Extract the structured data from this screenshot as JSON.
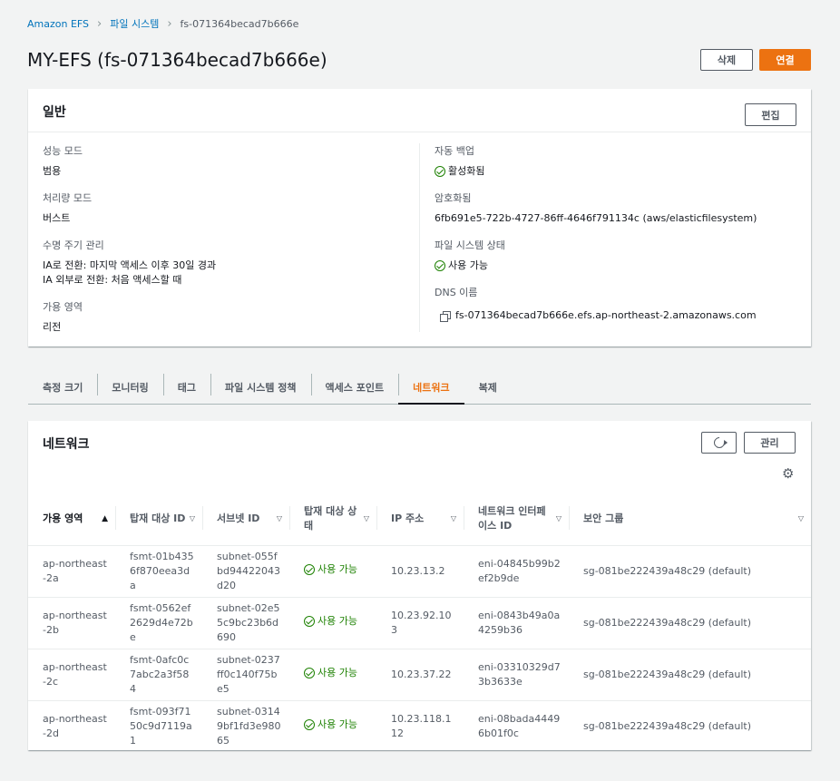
{
  "breadcrumb": [
    "Amazon EFS",
    "파일 시스템",
    "fs-071364becad7b666e"
  ],
  "title": "MY-EFS (fs-071364becad7b666e)",
  "actions": {
    "delete": "삭제",
    "connect": "연결"
  },
  "general": {
    "heading": "일반",
    "edit": "편집",
    "performance_mode": {
      "label": "성능 모드",
      "value": "범용"
    },
    "throughput_mode": {
      "label": "처리량 모드",
      "value": "버스트"
    },
    "lifecycle": {
      "label": "수명 주기 관리",
      "value1": "IA로 전환: 마지막 액세스 이후 30일 경과",
      "value2": "IA 외부로 전환: 처음 액세스할 때"
    },
    "availability_zone": {
      "label": "가용 영역",
      "value": "리전"
    },
    "auto_backup": {
      "label": "자동 백업",
      "value": "활성화됨"
    },
    "encryption": {
      "label": "암호화됨",
      "value": "6fb691e5-722b-4727-86ff-4646f791134c (aws/elasticfilesystem)"
    },
    "fs_state": {
      "label": "파일 시스템 상태",
      "value": "사용 가능"
    },
    "dns": {
      "label": "DNS 이름",
      "value": "fs-071364becad7b666e.efs.ap-northeast-2.amazonaws.com"
    }
  },
  "tabs": [
    "측정 크기",
    "모니터링",
    "태그",
    "파일 시스템 정책",
    "액세스 포인트",
    "네트워크",
    "복제"
  ],
  "active_tab": "네트워크",
  "network": {
    "heading": "네트워크",
    "manage": "관리",
    "columns": [
      {
        "label": "가용 영역",
        "sort": "▲"
      },
      {
        "label": "탑재 대상 ID",
        "sort": "▽"
      },
      {
        "label": "서브넷 ID",
        "sort": "▽"
      },
      {
        "label": "탑재 대상 상태",
        "sort": "▽"
      },
      {
        "label": "IP 주소",
        "sort": "▽"
      },
      {
        "label": "네트워크 인터페이스 ID",
        "sort": "▽"
      },
      {
        "label": "보안 그룹",
        "sort": "▽"
      }
    ],
    "rows": [
      {
        "az": "ap-northeast-2a",
        "mt": "fsmt-01b4356f870eea3da",
        "subnet": "subnet-055fbd94422043d20",
        "state": "사용 가능",
        "ip": "10.23.13.2",
        "eni": "eni-04845b99b2ef2b9de",
        "sg": "sg-081be222439a48c29 (default)"
      },
      {
        "az": "ap-northeast-2b",
        "mt": "fsmt-0562ef2629d4e72be",
        "subnet": "subnet-02e55c9bc23b6d690",
        "state": "사용 가능",
        "ip": "10.23.92.103",
        "eni": "eni-0843b49a0a4259b36",
        "sg": "sg-081be222439a48c29 (default)"
      },
      {
        "az": "ap-northeast-2c",
        "mt": "fsmt-0afc0c7abc2a3f584",
        "subnet": "subnet-0237ff0c140f75be5",
        "state": "사용 가능",
        "ip": "10.23.37.22",
        "eni": "eni-03310329d73b3633e",
        "sg": "sg-081be222439a48c29 (default)"
      },
      {
        "az": "ap-northeast-2d",
        "mt": "fsmt-093f7150c9d7119a1",
        "subnet": "subnet-03149bf1fd3e98065",
        "state": "사용 가능",
        "ip": "10.23.118.112",
        "eni": "eni-08bada44496b01f0c",
        "sg": "sg-081be222439a48c29 (default)"
      }
    ]
  },
  "colors": {
    "accent": "#ec7211",
    "link": "#0073bb",
    "success": "#1d8102"
  }
}
